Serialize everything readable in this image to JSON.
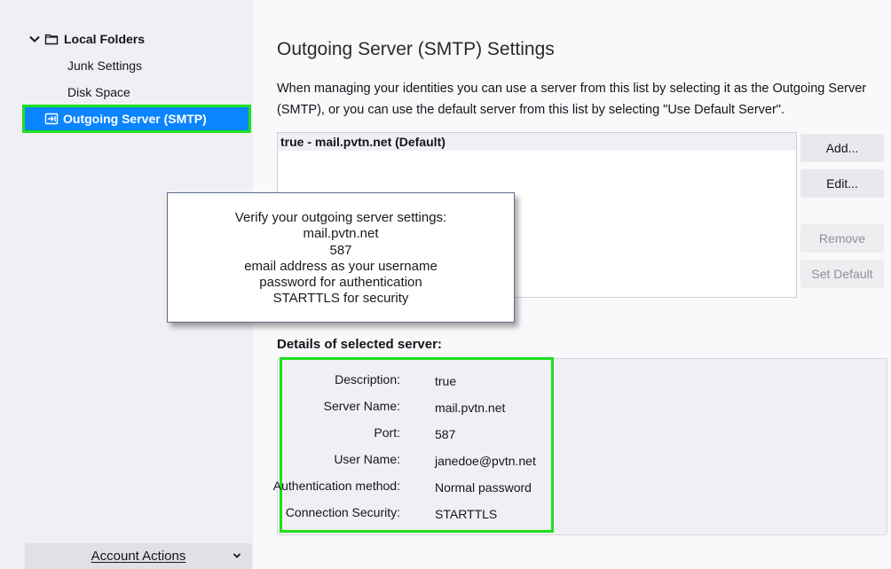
{
  "sidebar": {
    "folder_label": "Local Folders",
    "items": [
      {
        "label": "Junk Settings"
      },
      {
        "label": "Disk Space"
      },
      {
        "label": "Outgoing Server (SMTP)"
      }
    ],
    "account_actions_label": "Account Actions"
  },
  "main": {
    "title": "Outgoing Server (SMTP) Settings",
    "description": "When managing your identities you can use a server from this list by selecting it as the Outgoing Server (SMTP), or you can use the default server from this list by selecting \"Use Default Server\".",
    "server_list": [
      {
        "label": "true - mail.pvtn.net (Default)"
      }
    ],
    "buttons": {
      "add": "Add...",
      "edit": "Edit...",
      "remove": "Remove",
      "set_default": "Set Default"
    },
    "details_heading": "Details of selected server:",
    "details": {
      "description_label": "Description:",
      "description_value": "true",
      "server_name_label": "Server Name:",
      "server_name_value": "mail.pvtn.net",
      "port_label": "Port:",
      "port_value": "587",
      "user_name_label": "User Name:",
      "user_name_value": "janedoe@pvtn.net",
      "auth_label": "Authentication method:",
      "auth_value": "Normal password",
      "security_label": "Connection Security:",
      "security_value": "STARTTLS"
    }
  },
  "callout": {
    "lines": [
      "Verify your outgoing server settings:",
      "mail.pvtn.net",
      "587",
      "email address as your username",
      "password for authentication",
      "STARTTLS for security"
    ]
  },
  "colors": {
    "selection": "#0a84ff",
    "highlight_outline": "#1ee01e",
    "sidebar_bg": "#f0f0f4",
    "page_bg": "#f9f9fb"
  },
  "icons": {
    "tree_toggle": "chevron-down-icon",
    "folder": "folder-icon",
    "smtp": "outgoing-server-icon",
    "account_actions": "chevron-down-icon"
  }
}
